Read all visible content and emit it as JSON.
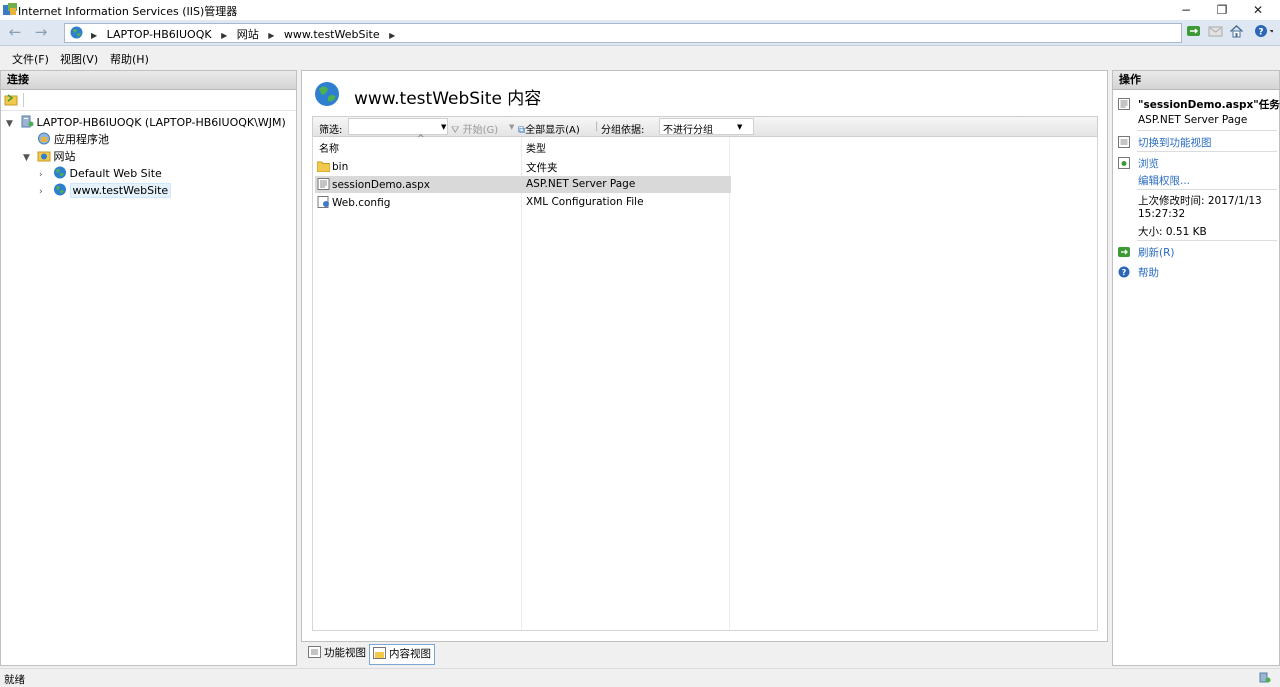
{
  "window": {
    "title": "Internet Information Services (IIS)管理器",
    "controls": [
      "−",
      "❐",
      "✕"
    ]
  },
  "address": {
    "crumbs": [
      "LAPTOP-HB6IUOQK",
      "网站",
      "www.testWebSite"
    ]
  },
  "menu": [
    "文件(F)",
    "视图(V)",
    "帮助(H)"
  ],
  "connections": {
    "header": "连接",
    "tree": [
      {
        "label": "LAPTOP-HB6IUOQK (LAPTOP-HB6IUOQK\\WJM)",
        "icon": "server-icon"
      },
      {
        "label": "应用程序池",
        "icon": "app-pool-icon"
      },
      {
        "label": "网站",
        "icon": "sites-folder-icon"
      },
      {
        "label": "Default Web Site",
        "icon": "website-icon"
      },
      {
        "label": "www.testWebSite",
        "icon": "website-icon",
        "selected": true
      }
    ]
  },
  "content": {
    "title": "www.testWebSite 内容",
    "filter": {
      "label": "筛选:",
      "go": "开始(G)",
      "show_all": "全部显示(A)",
      "group_by_label": "分组依据:",
      "group_by_value": "不进行分组"
    },
    "columns": [
      "名称",
      "类型"
    ],
    "items": [
      {
        "name": "bin",
        "type": "文件夹",
        "icon": "folder-icon"
      },
      {
        "name": "sessionDemo.aspx",
        "type": "ASP.NET Server Page",
        "icon": "aspx-file-icon",
        "selected": true
      },
      {
        "name": "Web.config",
        "type": "XML Configuration File",
        "icon": "config-file-icon"
      }
    ],
    "tabs": [
      "功能视图",
      "内容视图"
    ]
  },
  "actions": {
    "header": "操作",
    "task_title": "\"sessionDemo.aspx\"任务",
    "file_type": "ASP.NET Server Page",
    "switch_view": "切换到功能视图",
    "browse": "浏览",
    "edit_permissions": "编辑权限...",
    "modified_label": "上次修改时间: 2017/1/13",
    "modified_time": "15:27:32",
    "size": "大小: 0.51 KB",
    "refresh": "刷新(R)",
    "help": "帮助"
  },
  "status": {
    "text": "就绪"
  },
  "colors": {
    "selection": "#d9d9d9",
    "link": "#2a6dc1",
    "tree_selection": "#e5f1fb"
  }
}
